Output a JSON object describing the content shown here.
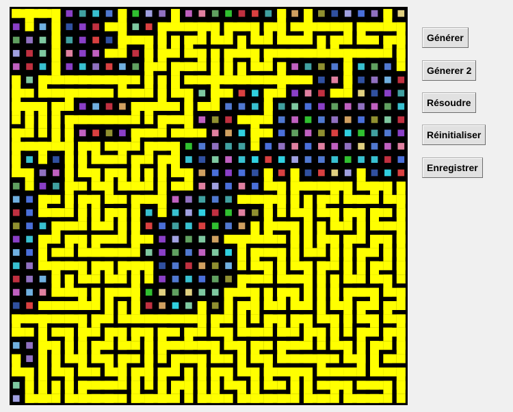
{
  "buttons": {
    "generate": "Générer",
    "generate2": "Génerer 2",
    "solve": "Résoudre",
    "reset": "Réinitialiser",
    "save": "Enregistrer"
  },
  "maze": {
    "rows": 30,
    "cols": 30,
    "path_color": "#ffff00",
    "wall_color": "#000000",
    "tile_palette": [
      "#7ec8a0",
      "#d94040",
      "#4a6fd9",
      "#8a3fc7",
      "#38c0d0",
      "#d0a060",
      "#60a060",
      "#c060c0",
      "#3050a0",
      "#a0a0e0",
      "#e080a0",
      "#40a0a0",
      "#909030",
      "#5078d0",
      "#30c030",
      "#e0d080",
      "#9070c0",
      "#30d0e0",
      "#c03040",
      "#70b0e0"
    ]
  }
}
